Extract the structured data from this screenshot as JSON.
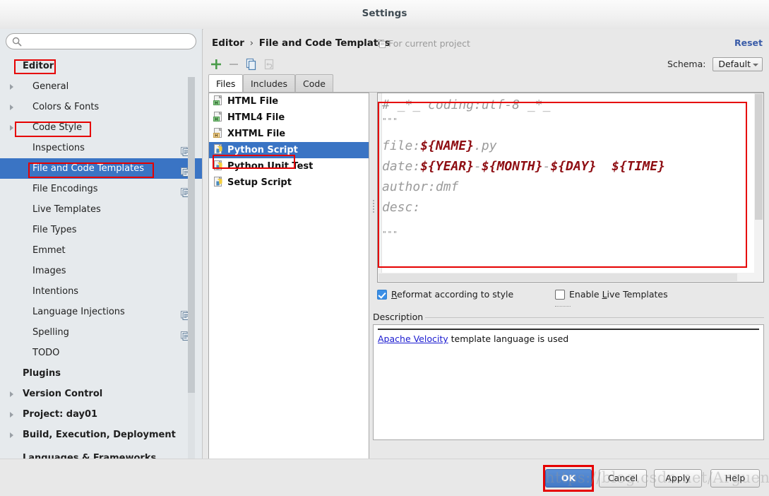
{
  "window": {
    "title": "Settings"
  },
  "sidebar": {
    "search": {
      "value": "",
      "placeholder": "",
      "icon": "search-icon"
    },
    "items": [
      {
        "label": "Editor",
        "depth": 0,
        "arrow": false,
        "bold": true,
        "selected": false,
        "copy": false
      },
      {
        "label": "General",
        "depth": 1,
        "arrow": true,
        "bold": false,
        "selected": false,
        "copy": false
      },
      {
        "label": "Colors & Fonts",
        "depth": 1,
        "arrow": true,
        "bold": false,
        "selected": false,
        "copy": false
      },
      {
        "label": "Code Style",
        "depth": 1,
        "arrow": true,
        "bold": false,
        "selected": false,
        "copy": false
      },
      {
        "label": "Inspections",
        "depth": 1,
        "arrow": false,
        "bold": false,
        "selected": false,
        "copy": true
      },
      {
        "label": "File and Code Templates",
        "depth": 1,
        "arrow": false,
        "bold": false,
        "selected": true,
        "copy": true
      },
      {
        "label": "File Encodings",
        "depth": 1,
        "arrow": false,
        "bold": false,
        "selected": false,
        "copy": true
      },
      {
        "label": "Live Templates",
        "depth": 1,
        "arrow": false,
        "bold": false,
        "selected": false,
        "copy": false
      },
      {
        "label": "File Types",
        "depth": 1,
        "arrow": false,
        "bold": false,
        "selected": false,
        "copy": false
      },
      {
        "label": "Emmet",
        "depth": 1,
        "arrow": false,
        "bold": false,
        "selected": false,
        "copy": false
      },
      {
        "label": "Images",
        "depth": 1,
        "arrow": false,
        "bold": false,
        "selected": false,
        "copy": false
      },
      {
        "label": "Intentions",
        "depth": 1,
        "arrow": false,
        "bold": false,
        "selected": false,
        "copy": false
      },
      {
        "label": "Language Injections",
        "depth": 1,
        "arrow": false,
        "bold": false,
        "selected": false,
        "copy": true
      },
      {
        "label": "Spelling",
        "depth": 1,
        "arrow": false,
        "bold": false,
        "selected": false,
        "copy": true
      },
      {
        "label": "TODO",
        "depth": 1,
        "arrow": false,
        "bold": false,
        "selected": false,
        "copy": false
      },
      {
        "label": "Plugins",
        "depth": 0,
        "arrow": false,
        "bold": true,
        "selected": false,
        "copy": false
      },
      {
        "label": "Version Control",
        "depth": 0,
        "arrow": true,
        "bold": true,
        "selected": false,
        "copy": false
      },
      {
        "label": "Project: day01",
        "depth": 0,
        "arrow": true,
        "bold": true,
        "selected": false,
        "copy": false
      },
      {
        "label": "Build, Execution, Deployment",
        "depth": 0,
        "arrow": true,
        "bold": true,
        "selected": false,
        "copy": false
      }
    ],
    "cut_item": {
      "label": "Languages & Frameworks",
      "depth": 0,
      "arrow": true,
      "bold": true
    }
  },
  "header": {
    "breadcrumb_root": "Editor",
    "breadcrumb_separator": "›",
    "breadcrumb_leaf": "File and Code Templates",
    "scope_note": "For current project",
    "scope_icon": "copy-scope-icon",
    "reset_label": "Reset",
    "schema_label": "Schema:",
    "schema_value": "Default"
  },
  "toolbar": {
    "buttons": [
      {
        "name": "add-template-button",
        "icon": "plus-icon",
        "enabled": true
      },
      {
        "name": "remove-template-button",
        "icon": "minus-icon",
        "enabled": false
      },
      {
        "name": "copy-template-button",
        "icon": "copy-icon",
        "enabled": true
      },
      {
        "name": "reset-template-button",
        "icon": "reset-arrow-icon",
        "enabled": false
      }
    ]
  },
  "tabs": [
    {
      "label": "Files",
      "active": true
    },
    {
      "label": "Includes",
      "active": false
    },
    {
      "label": "Code",
      "active": false
    }
  ],
  "template_list": [
    {
      "label": "HTML File",
      "icon": "html-file-icon",
      "selected": false
    },
    {
      "label": "HTML4 File",
      "icon": "html-file-icon",
      "selected": false
    },
    {
      "label": "XHTML File",
      "icon": "xhtml-file-icon",
      "selected": false
    },
    {
      "label": "Python Script",
      "icon": "python-file-icon",
      "selected": true
    },
    {
      "label": "Python Unit Test",
      "icon": "python-file-icon",
      "selected": false
    },
    {
      "label": "Setup Script",
      "icon": "python-file-icon",
      "selected": false
    }
  ],
  "editor": {
    "lines": [
      {
        "type": "code",
        "text": "# _*_ coding:utf-8 _*_"
      },
      {
        "type": "quote",
        "text": "\"\"\""
      },
      {
        "type": "blank",
        "text": ""
      },
      {
        "type": "mixed",
        "parts": [
          {
            "t": "file:",
            "var": false
          },
          {
            "t": "${NAME}",
            "var": true
          },
          {
            "t": ".py",
            "var": false
          }
        ]
      },
      {
        "type": "mixed",
        "parts": [
          {
            "t": "date:",
            "var": false
          },
          {
            "t": "${YEAR}",
            "var": true
          },
          {
            "t": "-",
            "var": false
          },
          {
            "t": "${MONTH}",
            "var": true
          },
          {
            "t": "-",
            "var": false
          },
          {
            "t": "${DAY}",
            "var": true
          },
          {
            "t": "  ",
            "var": false
          },
          {
            "t": "${TIME}",
            "var": true
          }
        ]
      },
      {
        "type": "code",
        "text": "author:dmf"
      },
      {
        "type": "code",
        "text": "desc:"
      },
      {
        "type": "blank",
        "text": ""
      },
      {
        "type": "quote",
        "text": "\"\"\""
      }
    ]
  },
  "options": {
    "reformat": {
      "label_pre": "",
      "label_accel": "R",
      "label_post": "eformat according to style",
      "checked": true
    },
    "live_templates": {
      "label_pre": "Enable ",
      "label_accel": "L",
      "label_post": "ive Templates",
      "checked": false
    }
  },
  "description": {
    "group_title": "Description",
    "link_text": "Apache Velocity",
    "rest_text": " template language is used"
  },
  "footer": {
    "buttons": [
      {
        "label": "OK",
        "primary": true
      },
      {
        "label": "Cancel",
        "primary": false
      },
      {
        "label": "Apply",
        "primary": false
      },
      {
        "label": "Help",
        "primary": false
      }
    ],
    "watermark": "https://blog.csdn.net/Arguen_D"
  },
  "colors": {
    "selection_blue": "#3a74c4",
    "annotation_red": "#e60000",
    "link_blue": "#1a1ad0",
    "variable_red": "#8e0d12",
    "code_gray": "#9b9b9b"
  }
}
